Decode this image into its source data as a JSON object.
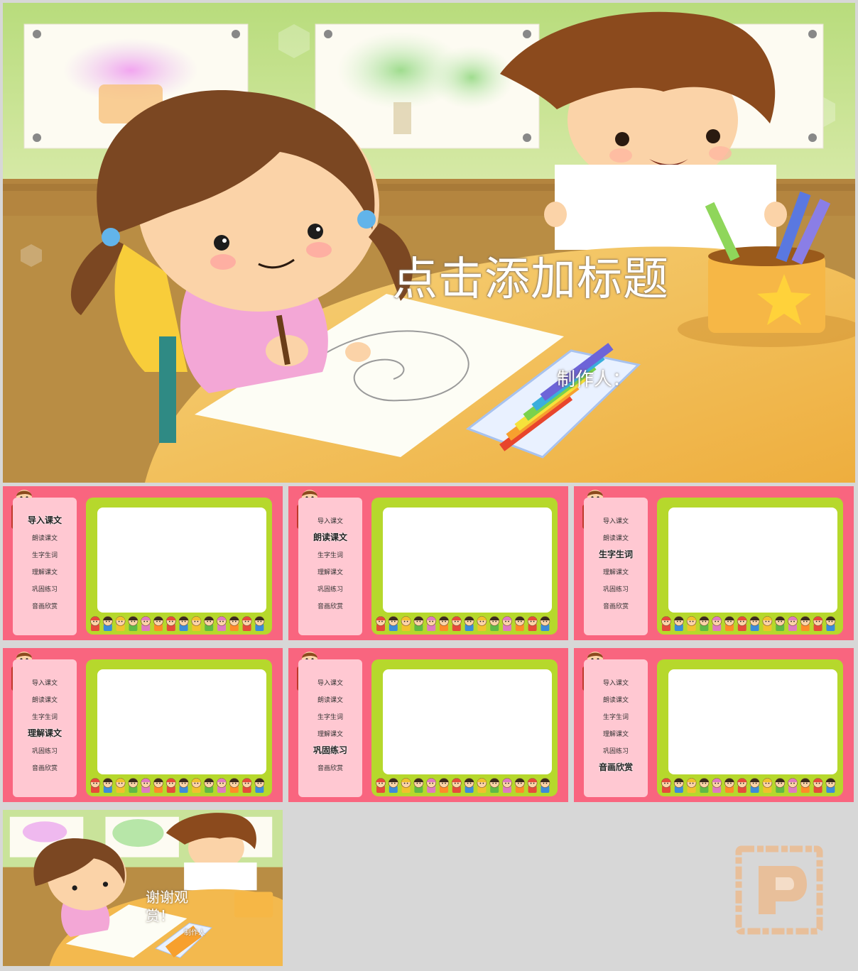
{
  "title_slide": {
    "title": "点击添加标题",
    "author": "制作人："
  },
  "menu_items": [
    "导入课文",
    "朗读课文",
    "生字生词",
    "理解课文",
    "巩固练习",
    "音画欣赏"
  ],
  "thumbnails": [
    {
      "active_index": 0
    },
    {
      "active_index": 1
    },
    {
      "active_index": 2
    },
    {
      "active_index": 3
    },
    {
      "active_index": 4
    },
    {
      "active_index": 5
    }
  ],
  "end_slide": {
    "title": "谢谢观赏！",
    "author": "制作人"
  },
  "colors": {
    "slide_pink": "#f9657f",
    "menu_pink": "#ffc8d2",
    "frame_green": "#b6d82c",
    "wall_green": "#c9e39a",
    "table_orange": "#f3b94e",
    "watermark": "#e8bf9a"
  },
  "icons": [
    "logo-stamp-icon"
  ]
}
